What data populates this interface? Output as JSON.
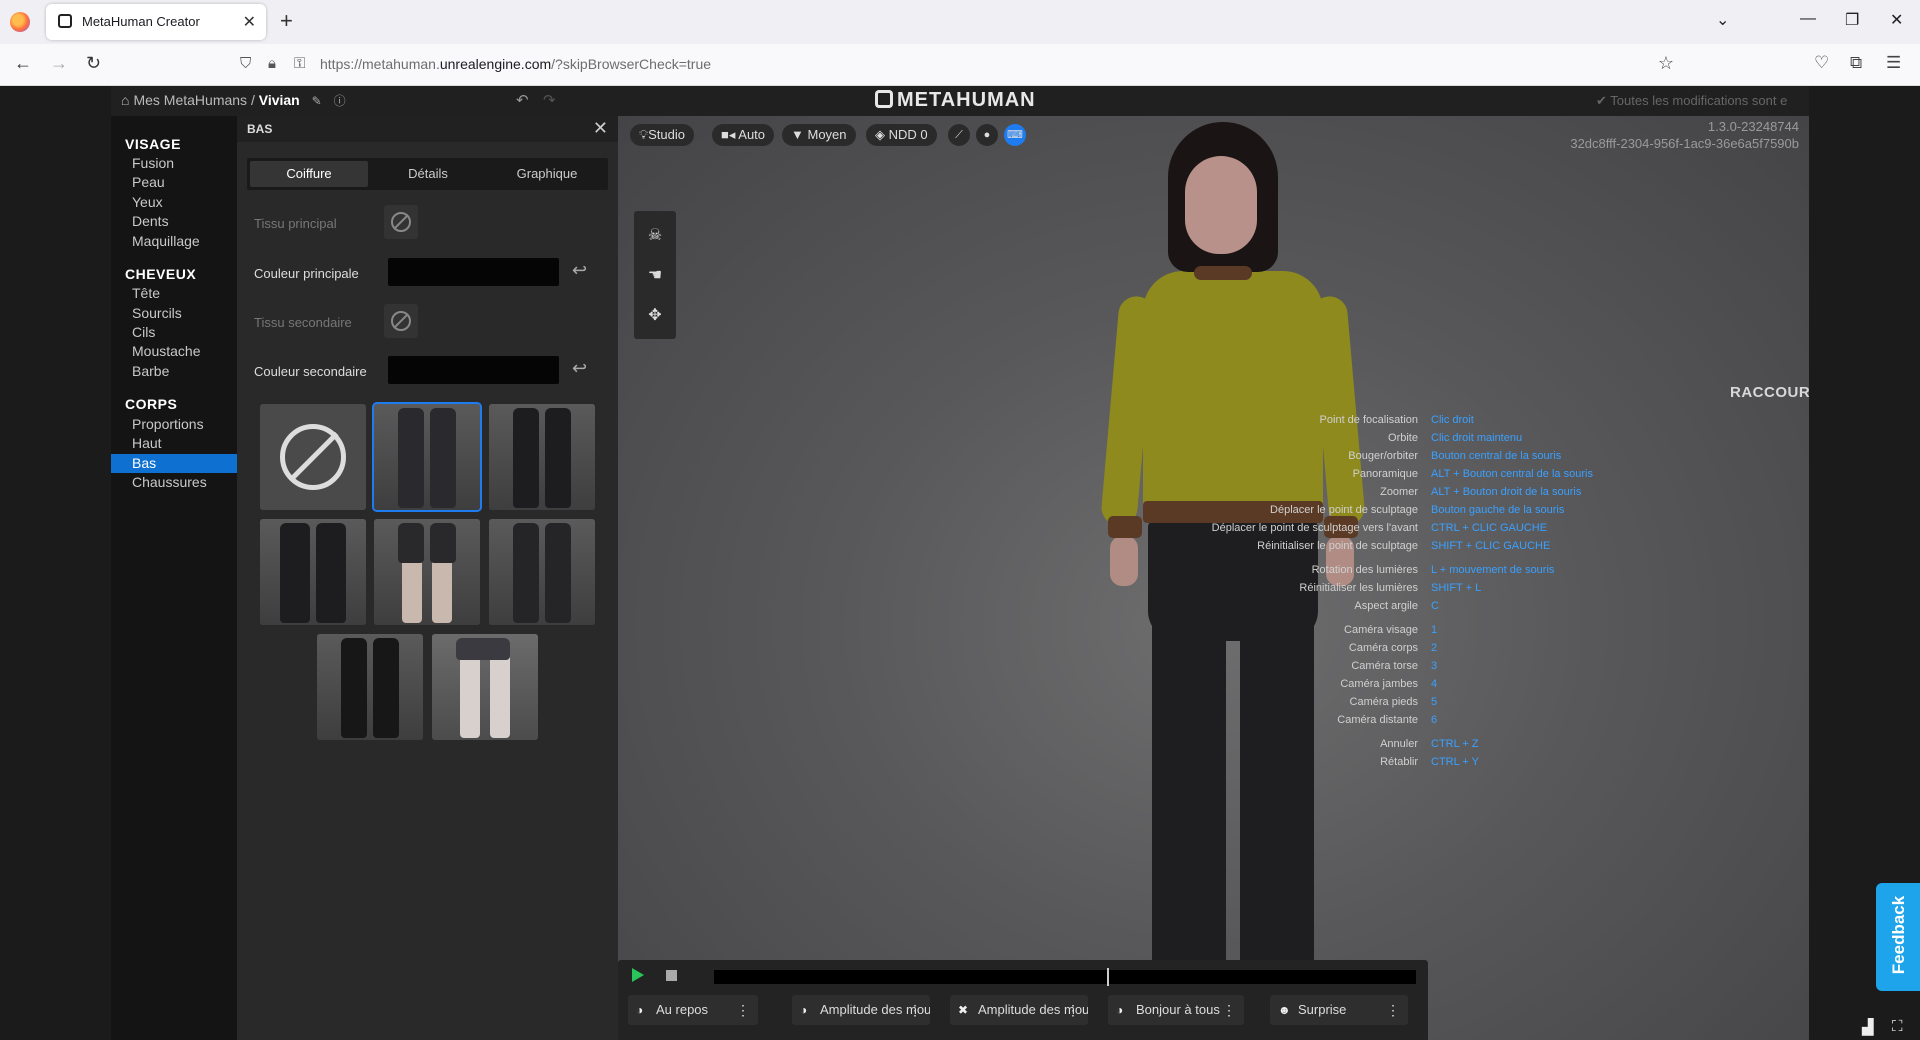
{
  "browser": {
    "tab_title": "MetaHuman Creator",
    "url_prefix": "https://metahuman.",
    "url_domain": "unrealengine.com",
    "url_suffix": "/?skipBrowserCheck=true"
  },
  "app": {
    "breadcrumb_root": "Mes MetaHumans /",
    "breadcrumb_current": "Vivian",
    "logo": "METAHUMAN",
    "save_status": "Toutes les modifications sont e"
  },
  "sidebar": {
    "sections": [
      {
        "title": "VISAGE",
        "items": [
          "Fusion",
          "Peau",
          "Yeux",
          "Dents",
          "Maquillage"
        ]
      },
      {
        "title": "CHEVEUX",
        "items": [
          "Tête",
          "Sourcils",
          "Cils",
          "Moustache",
          "Barbe"
        ]
      },
      {
        "title": "CORPS",
        "items": [
          "Proportions",
          "Haut",
          "Bas",
          "Chaussures"
        ]
      }
    ],
    "active_item": "Bas"
  },
  "panel": {
    "title": "BAS",
    "tabs": [
      "Coiffure",
      "Détails",
      "Graphique"
    ],
    "active_tab": "Coiffure",
    "props": {
      "fabric_primary": "Tissu principal",
      "color_primary": "Couleur principale",
      "fabric_secondary": "Tissu secondaire",
      "color_secondary": "Couleur secondaire"
    },
    "color_primary_hex": "#050505",
    "color_secondary_hex": "#050505"
  },
  "viewport": {
    "pills": {
      "lighting": "Studio",
      "camera": "Auto",
      "quality": "Moyen",
      "lod": "NDD 0"
    },
    "version": "1.3.0-23248744",
    "guid": "32dc8fff-2304-956f-1ac9-36e6a5f7590b"
  },
  "shortcuts": {
    "title": "RACCOURCIS CLAVIER",
    "rows": [
      {
        "k": "Point de focalisation",
        "v": "Clic droit"
      },
      {
        "k": "Orbite",
        "v": "Clic droit maintenu"
      },
      {
        "k": "Bouger/orbiter",
        "v": "Bouton central de la souris"
      },
      {
        "k": "Panoramique",
        "v": "ALT + Bouton central de la souris"
      },
      {
        "k": "Zoomer",
        "v": "ALT + Bouton droit de la souris"
      },
      {
        "k": "Déplacer le point de sculptage",
        "v": "Bouton gauche de la souris"
      },
      {
        "k": "Déplacer le point de sculptage vers l'avant",
        "v": "CTRL + CLIC GAUCHE"
      },
      {
        "k": "Réinitialiser le point de sculptage",
        "v": "SHIFT + CLIC GAUCHE"
      },
      {
        "k": "Rotation des lumières",
        "v": "L + mouvement de souris"
      },
      {
        "k": "Réinitialiser les lumières",
        "v": "SHIFT + L"
      },
      {
        "k": "Aspect argile",
        "v": "C"
      },
      {
        "k": "Caméra visage",
        "v": "1"
      },
      {
        "k": "Caméra corps",
        "v": "2"
      },
      {
        "k": "Caméra torse",
        "v": "3"
      },
      {
        "k": "Caméra jambes",
        "v": "4"
      },
      {
        "k": "Caméra pieds",
        "v": "5"
      },
      {
        "k": "Caméra distante",
        "v": "6"
      },
      {
        "k": "Annuler",
        "v": "CTRL + Z"
      },
      {
        "k": "Rétablir",
        "v": "CTRL + Y"
      }
    ]
  },
  "playback": {
    "animations": [
      {
        "label": "Au repos"
      },
      {
        "label": "Amplitude des mouvements : faciale"
      },
      {
        "label": "Amplitude des mouvements : corporelle"
      },
      {
        "label": "Bonjour à tous"
      },
      {
        "label": "Surprise"
      }
    ]
  },
  "feedback_label": "Feedback",
  "colors": {
    "accent": "#0e70d1",
    "shortcut_value": "#3aa0ff",
    "play": "#29c45a",
    "feedback": "#1ea4ea"
  }
}
